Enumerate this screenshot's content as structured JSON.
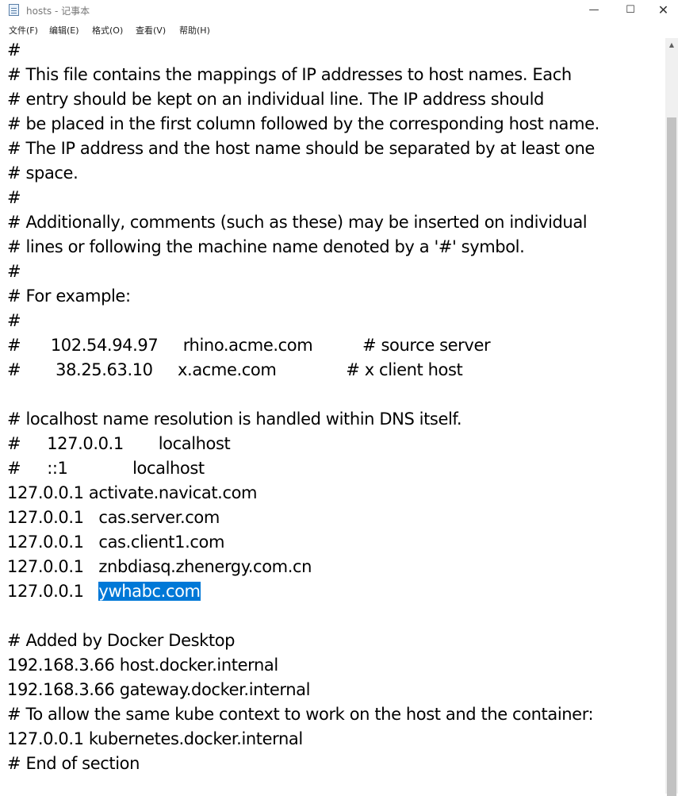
{
  "window": {
    "title": "hosts - 记事本",
    "icon": "notepad-icon",
    "controls": {
      "minimize": "—",
      "maximize": "☐",
      "close": "✕"
    }
  },
  "menu": [
    "文件(F)",
    "编辑(E)",
    "格式(O)",
    "查看(V)",
    "帮助(H)"
  ],
  "editor": {
    "lines": [
      "#",
      "# This file contains the mappings of IP addresses to host names. Each",
      "# entry should be kept on an individual line. The IP address should",
      "# be placed in the first column followed by the corresponding host name.",
      "# The IP address and the host name should be separated by at least one",
      "# space.",
      "#",
      "# Additionally, comments (such as these) may be inserted on individual",
      "# lines or following the machine name denoted by a '#' symbol.",
      "#",
      "# For example:",
      "#",
      "#      102.54.94.97     rhino.acme.com          # source server",
      "#       38.25.63.10     x.acme.com              # x client host",
      "",
      "# localhost name resolution is handled within DNS itself.",
      "#\t127.0.0.1       localhost",
      "#\t::1             localhost",
      "127.0.0.1 activate.navicat.com",
      "127.0.0.1   cas.server.com",
      "127.0.0.1   cas.client1.com",
      "127.0.0.1   znbdiasq.zhenergy.com.cn",
      "127.0.0.1   ",
      "",
      "# Added by Docker Desktop",
      "192.168.3.66 host.docker.internal",
      "192.168.3.66 gateway.docker.internal",
      "# To allow the same kube context to work on the host and the container:",
      "127.0.0.1 kubernetes.docker.internal",
      "# End of section"
    ],
    "selected_text": "ywhabc.com",
    "selection_color": "#0078d7"
  },
  "scrollbar": {
    "up_arrow": "▲"
  }
}
